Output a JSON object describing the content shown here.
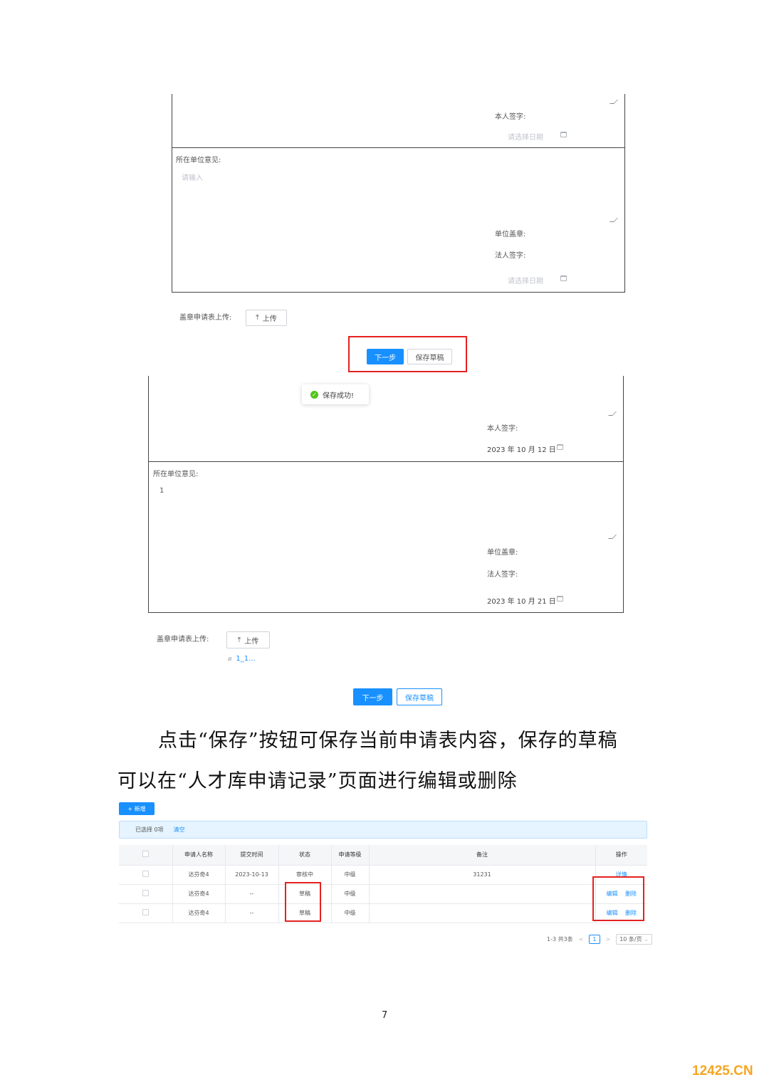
{
  "form1": {
    "self_sign_label": "本人签字:",
    "date_placeholder": "请选择日期",
    "unit_opinion_label": "所在单位意见:",
    "input_placeholder": "请输入",
    "unit_seal_label": "单位盖章:",
    "legal_sign_label": "法人签字:",
    "date_placeholder_2": "请选择日期",
    "upload_label": "盖章申请表上传:",
    "upload_button": "上传",
    "next_button": "下一步",
    "save_draft_button": "保存草稿"
  },
  "form2": {
    "toast_message": "保存成功!",
    "self_sign_label": "本人签字:",
    "self_sign_date": "2023 年 10 月 12 日",
    "unit_opinion_label": "所在单位意见:",
    "unit_opinion_value": "1",
    "unit_seal_label": "单位盖章:",
    "legal_sign_label": "法人签字:",
    "legal_sign_date": "2023 年 10 月 21 日",
    "upload_label": "盖章申请表上传:",
    "upload_button": "上传",
    "attachment_name": "1_1...",
    "next_button": "下一步",
    "save_draft_button": "保存草稿"
  },
  "paragraph": {
    "line1": "点击“保存”按钮可保存当前申请表内容，保存的草稿",
    "line2": "可以在“人才库申请记录”页面进行编辑或删除"
  },
  "records": {
    "add_button": "+ 新增",
    "selected_text": "已选择 0项",
    "clear_link": "清空",
    "columns": [
      "申请人名称",
      "提交时间",
      "状态",
      "申请等级",
      "备注",
      "操作"
    ],
    "rows": [
      {
        "name": "达芬奇4",
        "time": "2023-10-13",
        "status": "审核中",
        "level": "中级",
        "note": "31231",
        "action1": "详情",
        "action2": ""
      },
      {
        "name": "达芬奇4",
        "time": "--",
        "status": "草稿",
        "level": "中级",
        "note": "",
        "action1": "编辑",
        "action2": "删除"
      },
      {
        "name": "达芬奇4",
        "time": "--",
        "status": "草稿",
        "level": "中级",
        "note": "",
        "action1": "编辑",
        "action2": "删除"
      }
    ],
    "pager": {
      "summary": "1-3 共3条",
      "prev": "<",
      "current_page": "1",
      "next": ">",
      "page_size": "10 条/页"
    }
  },
  "page_number": "7",
  "watermark": "12425.CN",
  "colors": {
    "primary": "#1890ff",
    "highlight_red": "#e52121",
    "success_green": "#52c41a",
    "watermark_orange": "#f5a623"
  }
}
